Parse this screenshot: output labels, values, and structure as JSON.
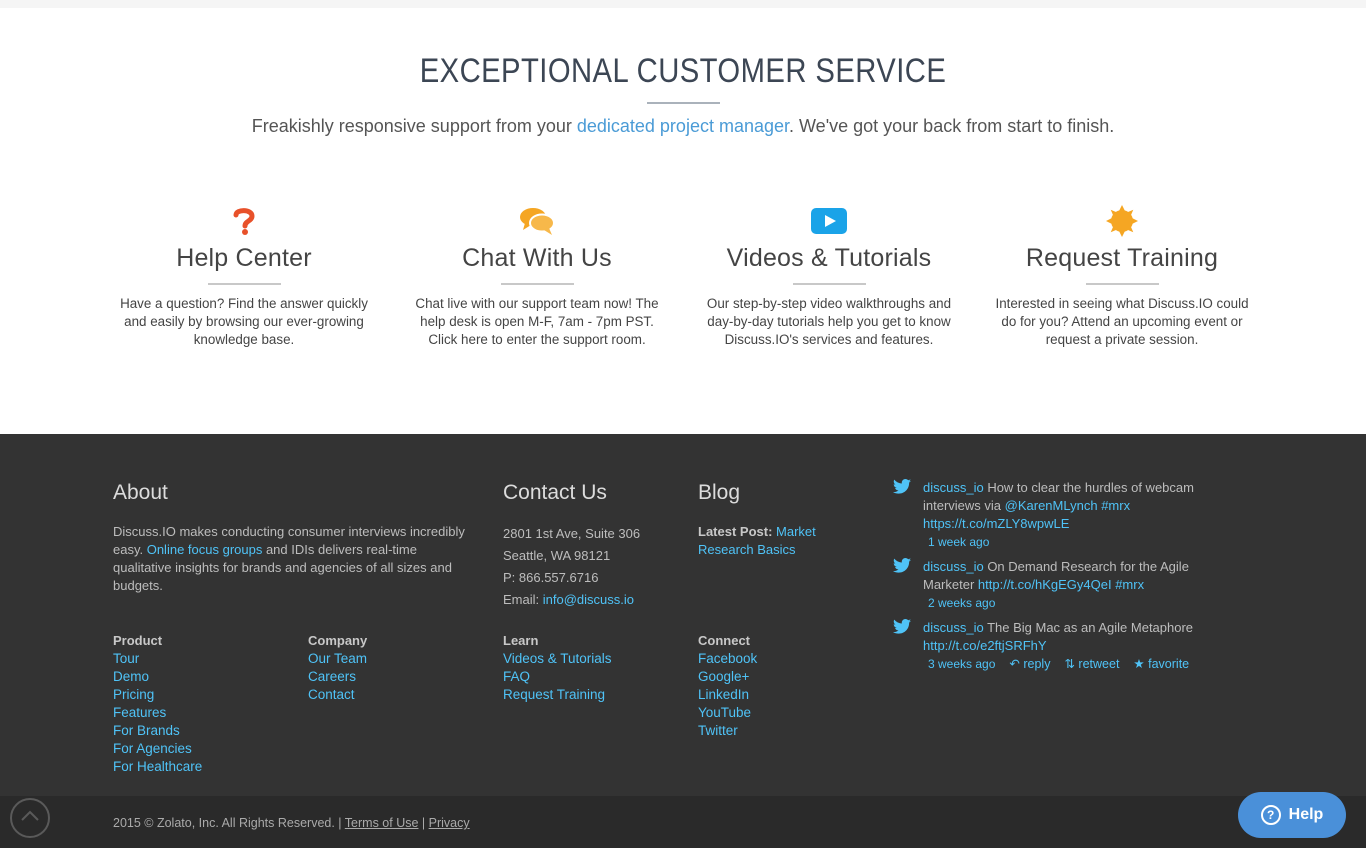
{
  "hero": {
    "title": "EXCEPTIONAL CUSTOMER SERVICE",
    "subtitle_before": "Freakishly responsive support from your ",
    "subtitle_link": "dedicated project manager",
    "subtitle_after": ". We've got your back from start to finish."
  },
  "features": [
    {
      "icon": "question-mark-icon",
      "title": "Help Center",
      "text": "Have a question? Find the answer quickly and easily by browsing our ever-growing knowledge base.",
      "icon_color": "#e8512a"
    },
    {
      "icon": "chat-bubbles-icon",
      "title": "Chat With Us",
      "text": "Chat live with our support team now! The help desk is open M-F, 7am - 7pm PST. Click here to enter the support room.",
      "icon_color": "#f5a623"
    },
    {
      "icon": "play-video-icon",
      "title": "Videos & Tutorials",
      "text": "Our step-by-step video walkthroughs and day-by-day tutorials help you get to know Discuss.IO's services and features.",
      "icon_color": "#1aa3e8"
    },
    {
      "icon": "badge-sun-icon",
      "title": "Request Training",
      "text": "Interested in seeing what Discuss.IO could do for you? Attend an upcoming event or request a private session.",
      "icon_color": "#f5a623"
    }
  ],
  "footer": {
    "about": {
      "heading": "About",
      "text_before": "Discuss.IO makes conducting consumer interviews incredibly easy. ",
      "link": "Online focus groups",
      "text_after": " and IDIs delivers real-time qualitative insights for brands and agencies of all sizes and budgets."
    },
    "contact": {
      "heading": "Contact Us",
      "address1": "2801 1st Ave, Suite 306",
      "address2": "Seattle, WA 98121",
      "phone": "P: 866.557.6716",
      "email_label": "Email: ",
      "email": "info@discuss.io"
    },
    "blog": {
      "heading": "Blog",
      "latest_label": "Latest Post:",
      "latest_link": " Market Research Basics"
    },
    "product": {
      "heading": "Product",
      "links": [
        "Tour",
        "Demo",
        "Pricing",
        "Features",
        "For Brands",
        "For Agencies",
        "For Healthcare"
      ]
    },
    "company": {
      "heading": "Company",
      "links": [
        "Our Team",
        "Careers",
        "Contact"
      ]
    },
    "learn": {
      "heading": "Learn",
      "links": [
        "Videos & Tutorials",
        "FAQ",
        "Request Training"
      ]
    },
    "connect": {
      "heading": "Connect",
      "links": [
        "Facebook",
        "Google+",
        "LinkedIn",
        "YouTube",
        "Twitter"
      ]
    },
    "tweets": [
      {
        "user": "discuss_io",
        "text1": " How to clear the hurdles of webcam interviews via ",
        "mention": "@KarenMLynch",
        "hashtag": " #mrx",
        "url": "https://t.co/mZLY8wpwLE",
        "time": "1 week ago"
      },
      {
        "user": "discuss_io",
        "text1": " On Demand Research for the Agile Marketer ",
        "url": "http://t.co/hKgEGy4QeI",
        "hashtag": " #mrx",
        "time": "2 weeks ago"
      },
      {
        "user": "discuss_io",
        "text1": " The Big Mac as an Agile Metaphore ",
        "url": "http://t.co/e2ftjSRFhY",
        "time": "3 weeks ago",
        "reply": "reply",
        "retweet": "retweet",
        "favorite": "favorite"
      }
    ]
  },
  "bottom": {
    "copyright": "2015 © Zolato, Inc. All Rights Reserved. | ",
    "terms": "Terms of Use",
    "sep": " | ",
    "privacy": "Privacy",
    "help_label": "Help"
  },
  "colors": {
    "accent_link": "#4fc3f7",
    "footer_bg": "#333333",
    "help_button": "#4a90d9"
  }
}
